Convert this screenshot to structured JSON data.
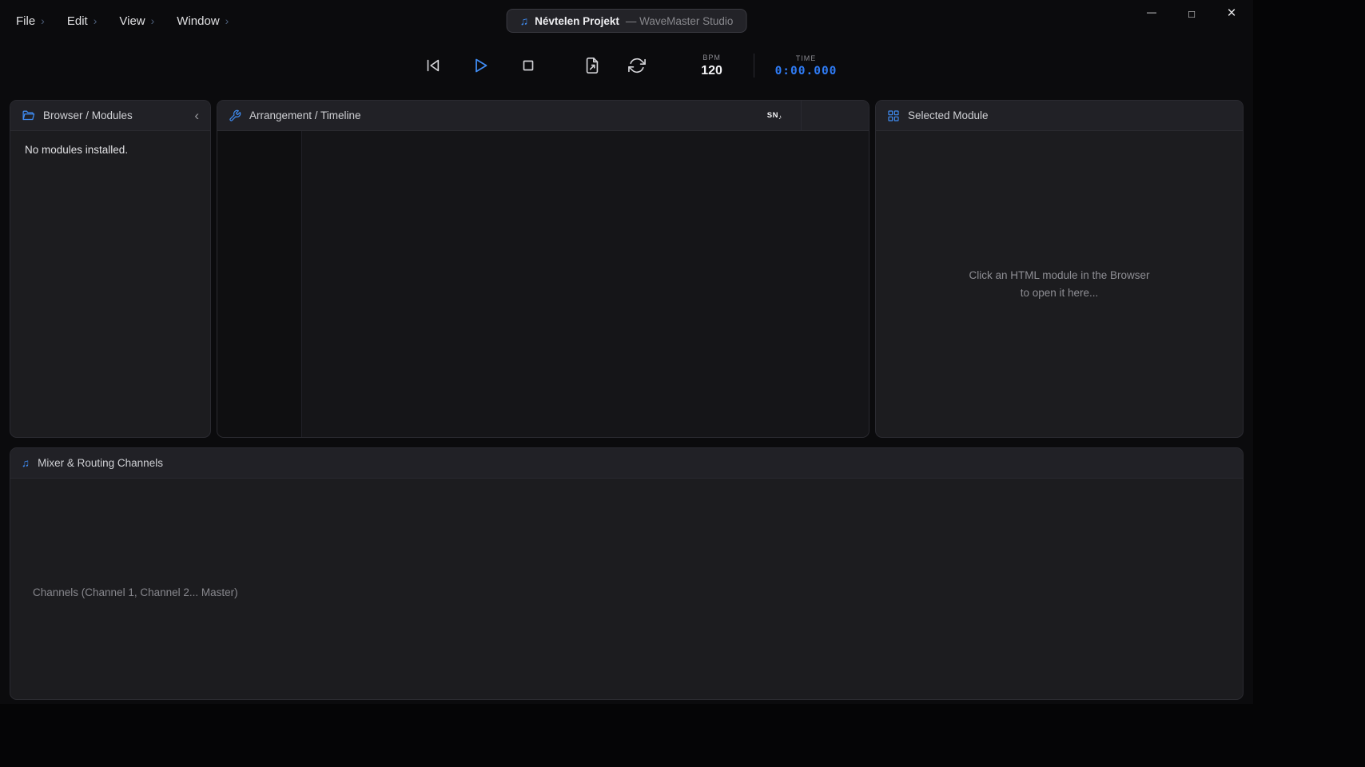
{
  "colors": {
    "accent": "#3f8cf3",
    "time": "#2f7cf6"
  },
  "icons": {
    "chevron_right": "›",
    "collapse_left": "‹",
    "music_note": "♫",
    "minimize": "—",
    "maximize": "□",
    "close": "×",
    "snap_note": "♪"
  },
  "menubar": {
    "items": [
      {
        "label": "File"
      },
      {
        "label": "Edit"
      },
      {
        "label": "View"
      },
      {
        "label": "Window"
      }
    ]
  },
  "titlebar": {
    "project_name": "Névtelen Projekt",
    "app_suffix": "— WaveMaster Studio"
  },
  "transport": {
    "bpm_label": "BPM",
    "bpm_value": "120",
    "time_label": "TIME",
    "time_value": "0:00.000"
  },
  "panels": {
    "browser": {
      "title": "Browser / Modules",
      "empty_text": "No modules installed."
    },
    "arrangement": {
      "title": "Arrangement / Timeline",
      "snap_label": "SN"
    },
    "selected_module": {
      "title": "Selected Module",
      "placeholder_line1": "Click an HTML module in the Browser",
      "placeholder_line2": "to open it here..."
    },
    "mixer": {
      "title": "Mixer & Routing Channels",
      "channels_text": "Channels (Channel 1, Channel 2... Master)"
    }
  }
}
